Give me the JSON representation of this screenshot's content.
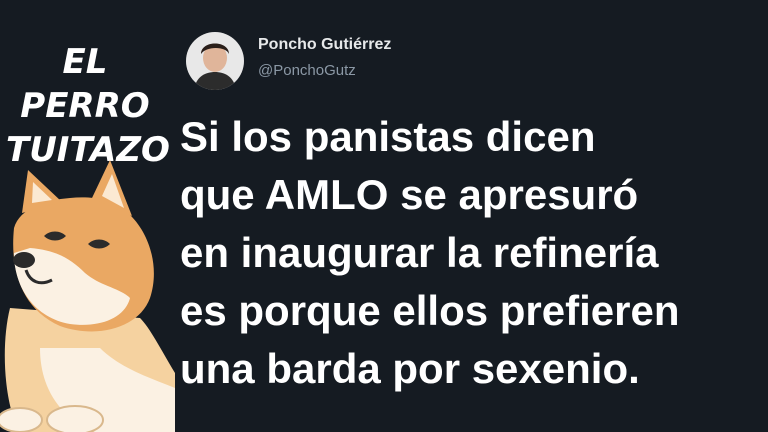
{
  "brand": {
    "line1": "EL PERRO",
    "line2": "TUITAZO"
  },
  "mascot": {
    "icon": "shiba-dog-illustration"
  },
  "tweet": {
    "author_name": "Poncho Gutiérrez",
    "author_handle": "@PonchoGutz",
    "avatar_icon": "profile-photo",
    "lines": [
      "Si los panistas dicen",
      "que AMLO se apresuró",
      "en inaugurar la refinería",
      "es porque ellos prefieren",
      "una barda por sexenio."
    ]
  },
  "colors": {
    "background": "#151b22",
    "text": "#ffffff",
    "handle": "#8b98a5"
  }
}
